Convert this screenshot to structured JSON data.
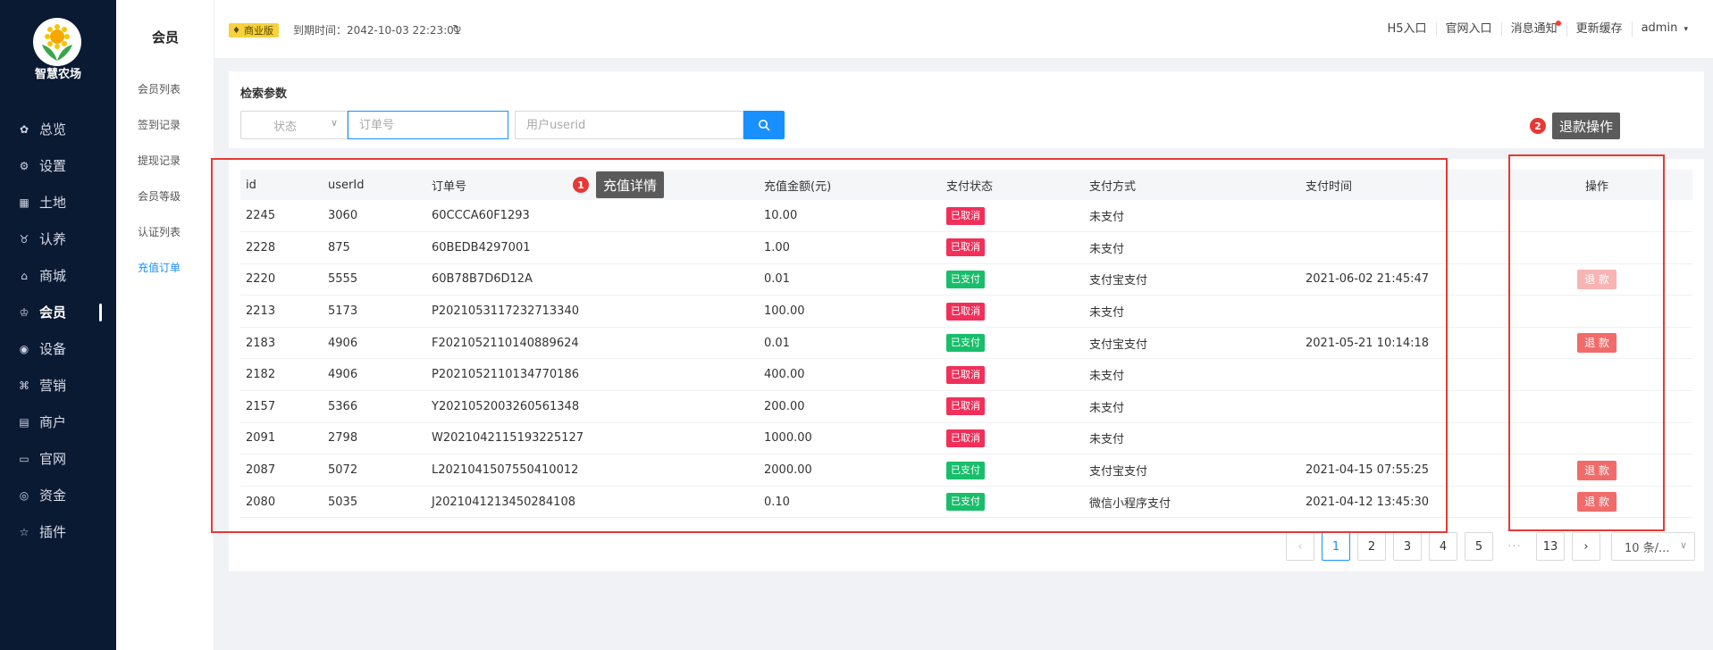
{
  "brand": {
    "name": "智慧农场"
  },
  "nav": [
    {
      "label": "总览",
      "icon": "dashboard-icon",
      "glyph": "✿"
    },
    {
      "label": "设置",
      "icon": "settings-icon",
      "glyph": "⚙"
    },
    {
      "label": "土地",
      "icon": "land-icon",
      "glyph": "▦"
    },
    {
      "label": "认养",
      "icon": "adopt-icon",
      "glyph": "♉"
    },
    {
      "label": "商城",
      "icon": "shop-icon",
      "glyph": "⌂"
    },
    {
      "label": "会员",
      "icon": "member-icon",
      "glyph": "♔"
    },
    {
      "label": "设备",
      "icon": "device-icon",
      "glyph": "◉"
    },
    {
      "label": "营销",
      "icon": "marketing-icon",
      "glyph": "⌘"
    },
    {
      "label": "商户",
      "icon": "merchant-icon",
      "glyph": "▤"
    },
    {
      "label": "官网",
      "icon": "website-icon",
      "glyph": "▭"
    },
    {
      "label": "资金",
      "icon": "funds-icon",
      "glyph": "◎"
    },
    {
      "label": "插件",
      "icon": "plugin-icon",
      "glyph": "☆"
    }
  ],
  "submenu": {
    "title": "会员",
    "items": [
      "会员列表",
      "签到记录",
      "提现记录",
      "会员等级",
      "认证列表",
      "充值订单"
    ]
  },
  "header": {
    "edition": "商业版",
    "expire": "到期时间：2042-10-03 22:23:01",
    "links": [
      "H5入口",
      "官网入口",
      "消息通知",
      "更新缓存",
      "admin"
    ]
  },
  "search": {
    "title": "检索参数",
    "status_placeholder": "状态",
    "order_placeholder": "订单号",
    "user_placeholder": "用户userid"
  },
  "table": {
    "columns": [
      "id",
      "userId",
      "订单号",
      "充值金额(元)",
      "支付状态",
      "支付方式",
      "支付时间",
      "操作"
    ],
    "rows": [
      {
        "id": "2245",
        "userId": "3060",
        "order": "60CCCA60F1293",
        "amount": "10.00",
        "status": "已取消",
        "method": "未支付",
        "time": "",
        "action": ""
      },
      {
        "id": "2228",
        "userId": "875",
        "order": "60BEDB4297001",
        "amount": "1.00",
        "status": "已取消",
        "method": "未支付",
        "time": "",
        "action": ""
      },
      {
        "id": "2220",
        "userId": "5555",
        "order": "60B78B7D6D12A",
        "amount": "0.01",
        "status": "已支付",
        "method": "支付宝支付",
        "time": "2021-06-02 21:45:47",
        "action": "退 款"
      },
      {
        "id": "2213",
        "userId": "5173",
        "order": "P2021053117232713340",
        "amount": "100.00",
        "status": "已取消",
        "method": "未支付",
        "time": "",
        "action": ""
      },
      {
        "id": "2183",
        "userId": "4906",
        "order": "F2021052110140889624",
        "amount": "0.01",
        "status": "已支付",
        "method": "支付宝支付",
        "time": "2021-05-21 10:14:18",
        "action": "退 款"
      },
      {
        "id": "2182",
        "userId": "4906",
        "order": "P2021052110134770186",
        "amount": "400.00",
        "status": "已取消",
        "method": "未支付",
        "time": "",
        "action": ""
      },
      {
        "id": "2157",
        "userId": "5366",
        "order": "Y2021052003260561348",
        "amount": "200.00",
        "status": "已取消",
        "method": "未支付",
        "time": "",
        "action": ""
      },
      {
        "id": "2091",
        "userId": "2798",
        "order": "W2021042115193225127",
        "amount": "1000.00",
        "status": "已取消",
        "method": "未支付",
        "time": "",
        "action": ""
      },
      {
        "id": "2087",
        "userId": "5072",
        "order": "L2021041507550410012",
        "amount": "2000.00",
        "status": "已支付",
        "method": "支付宝支付",
        "time": "2021-04-15 07:55:25",
        "action": "退 款"
      },
      {
        "id": "2080",
        "userId": "5035",
        "order": "J2021041213450284108",
        "amount": "0.10",
        "status": "已支付",
        "method": "微信小程序支付",
        "time": "2021-04-12 13:45:30",
        "action": "退 款"
      }
    ]
  },
  "pagination": {
    "pages": [
      "1",
      "2",
      "3",
      "4",
      "5"
    ],
    "ellipsis": "···",
    "last": "13",
    "prev": "‹",
    "next": "›",
    "page_size": "10 条/..."
  },
  "annotations": [
    {
      "num": "1",
      "label": "充值详情"
    },
    {
      "num": "2",
      "label": "退款操作"
    }
  ],
  "colors": {
    "sidebar_bg": "#0b1a33",
    "accent": "#1890ff",
    "cancel_tag": "#f0305a",
    "paid_tag": "#19be6b",
    "refund_btn": "#f26b6b",
    "annotation_red": "#e53935"
  }
}
